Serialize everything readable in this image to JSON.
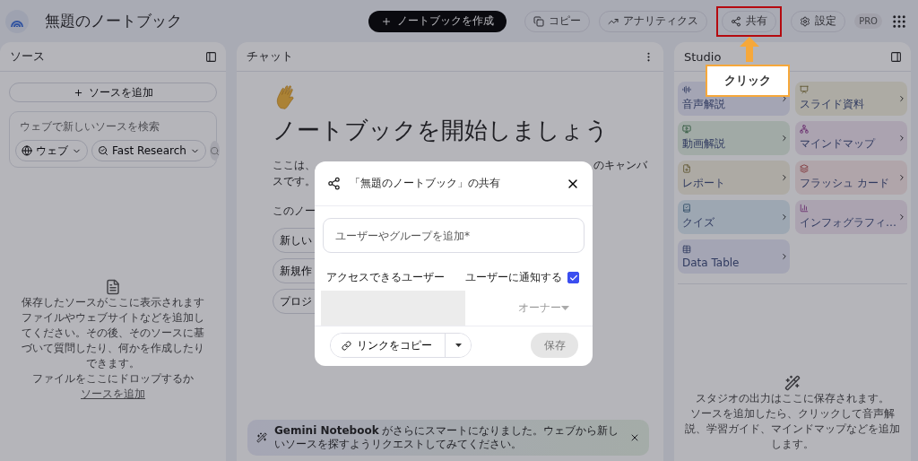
{
  "header": {
    "title": "無題のノートブック",
    "create_button": "ノートブックを作成",
    "actions": [
      {
        "label": "コピー",
        "kind": "copy",
        "highlighted": false
      },
      {
        "label": "アナリティクス",
        "kind": "analytics",
        "highlighted": false
      },
      {
        "label": "共有",
        "kind": "share",
        "highlighted": true
      },
      {
        "label": "設定",
        "kind": "settings",
        "highlighted": false
      }
    ],
    "badge": "PRO"
  },
  "annotation": {
    "label": "クリック"
  },
  "sources": {
    "title": "ソース",
    "add_button": "ソースを追加",
    "search": {
      "placeholder": "ウェブで新しいソースを検索",
      "chips": [
        {
          "label": "ウェブ",
          "kind": "web"
        },
        {
          "label": "Fast Research",
          "kind": "research"
        }
      ]
    },
    "empty": {
      "title": "保存したソースがここに表示されます",
      "text": "ファイルやウェブサイトなどを追加してください。その後、そのソースに基づいて質問したり、何かを作成したりできます。",
      "drop_text": "ファイルをここにドロップするか",
      "drop_link": "ソースを追加"
    }
  },
  "chat": {
    "title": "チャット",
    "heading": "ノートブックを開始しましょう",
    "intro_lines": [
      {
        "left": "ここは、",
        "right": "のキャンバ"
      },
      {
        "left": "スです。"
      }
    ],
    "suggest_label": "このノー",
    "suggestions": [
      "新しい",
      "新規作",
      "プロジ"
    ],
    "banner": {
      "text": "**Gemini Notebook** がさらにスマートになりました。ウェブから新しいソースを探すようリクエストしてみてください。"
    }
  },
  "studio": {
    "title": "Studio",
    "tiles": [
      {
        "label": "音声解説",
        "kind": "audio"
      },
      {
        "label": "スライド資料",
        "kind": "slides"
      },
      {
        "label": "動画解説",
        "kind": "video"
      },
      {
        "label": "マインドマップ",
        "kind": "mindmap"
      },
      {
        "label": "レポート",
        "kind": "report"
      },
      {
        "label": "フラッシュ カード",
        "kind": "flashcards"
      },
      {
        "label": "クイズ",
        "kind": "quiz"
      },
      {
        "label": "インフォグラフィ…",
        "kind": "infographic"
      },
      {
        "label": "Data Table",
        "kind": "table"
      }
    ],
    "empty": {
      "title": "スタジオの出力はここに保存されます。",
      "text": "ソースを追加したら、クリックして音声解説、学習ガイド、マインドマップなどを追加します。"
    }
  },
  "dialog": {
    "title": "「無題のノートブック」の共有",
    "input": {
      "placeholder": "ユーザーやグループを追加*"
    },
    "access_label": "アクセスできるユーザー",
    "notify": {
      "label": "ユーザーに通知する",
      "checked": true
    },
    "role": "オーナー",
    "copy_link": "リンクをコピー",
    "save": {
      "label": "保存",
      "disabled": true
    }
  }
}
